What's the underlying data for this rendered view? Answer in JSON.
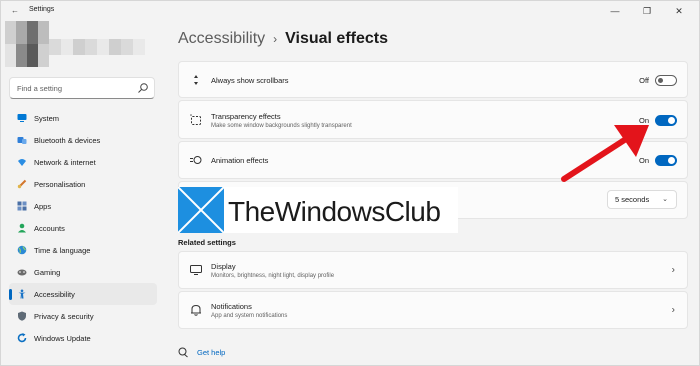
{
  "window": {
    "app_title": "Settings",
    "controls": [
      "—",
      "❐",
      "✕"
    ]
  },
  "sidebar": {
    "search_placeholder": "Find a setting",
    "items": [
      {
        "label": "System",
        "icon": "monitor-icon",
        "color": "#0078d4"
      },
      {
        "label": "Bluetooth & devices",
        "icon": "bluetooth-icon",
        "color": "#2f7fd8"
      },
      {
        "label": "Network & internet",
        "icon": "wifi-icon",
        "color": "#2b8de3"
      },
      {
        "label": "Personalisation",
        "icon": "brush-icon",
        "color": "#d2762d"
      },
      {
        "label": "Apps",
        "icon": "apps-icon",
        "color": "#4a6fa5"
      },
      {
        "label": "Accounts",
        "icon": "account-icon",
        "color": "#23a55a"
      },
      {
        "label": "Time & language",
        "icon": "globe-icon",
        "color": "#2a89d6"
      },
      {
        "label": "Gaming",
        "icon": "gamepad-icon",
        "color": "#6b6b6b"
      },
      {
        "label": "Accessibility",
        "icon": "accessibility-icon",
        "color": "#1a73c6",
        "active": true
      },
      {
        "label": "Privacy & security",
        "icon": "shield-icon",
        "color": "#5f6b77"
      },
      {
        "label": "Windows Update",
        "icon": "update-icon",
        "color": "#0a6fc2"
      }
    ]
  },
  "breadcrumb": {
    "parent": "Accessibility",
    "separator": "›",
    "current": "Visual effects"
  },
  "settings": {
    "scrollbars": {
      "title": "Always show scrollbars",
      "state_label": "Off",
      "on": false
    },
    "transparency": {
      "title": "Transparency effects",
      "subtitle": "Make some window backgrounds slightly transparent",
      "state_label": "On",
      "on": true
    },
    "animation": {
      "title": "Animation effects",
      "state_label": "On",
      "on": true
    },
    "notification_timeout": {
      "value": "5 seconds"
    }
  },
  "related": {
    "heading": "Related settings",
    "display": {
      "title": "Display",
      "subtitle": "Monitors, brightness, night light, display profile"
    },
    "notifications": {
      "title": "Notifications",
      "subtitle": "App and system notifications"
    }
  },
  "help": {
    "label": "Get help"
  },
  "watermark": {
    "text": "TheWindowsClub"
  },
  "colors": {
    "accent": "#0067c0",
    "arrow": "#e3141b",
    "logo_blue": "#1d8fe0"
  }
}
